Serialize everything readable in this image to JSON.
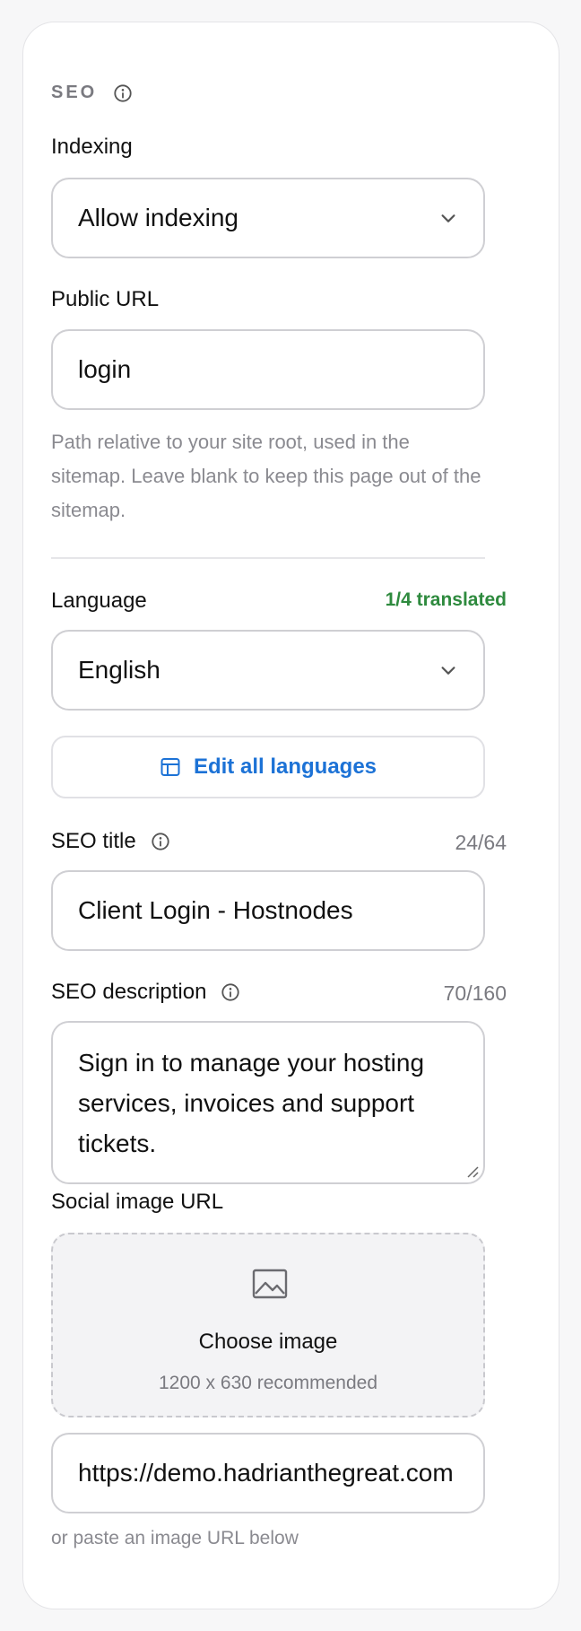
{
  "seo": {
    "section_title": "SEO",
    "indexing": {
      "label": "Indexing",
      "value": "Allow indexing"
    },
    "public_url": {
      "label": "Public URL",
      "value": "login",
      "help": "Path relative to your site root, used in the sitemap. Leave blank to keep this page out of the sitemap."
    },
    "language": {
      "label": "Language",
      "value": "English",
      "translated": "1/4 translated"
    },
    "edit_languages_label": "Edit all languages",
    "seo_title": {
      "label": "SEO title",
      "counter": "24/64",
      "value": "Client Login - Hostnodes"
    },
    "seo_description": {
      "label": "SEO description",
      "counter": "70/160",
      "value": "Sign in to manage your hosting services, invoices and support tickets."
    },
    "social_image": {
      "label": "Social image URL",
      "choose_label": "Choose image",
      "recommended": "1200 x 630 recommended",
      "url_value": "https://demo.hadrianthegreat.com",
      "help": "or paste an image URL below"
    }
  },
  "colors": {
    "accent": "#1c72d6",
    "success": "#2e8a3e",
    "border": "#cfcfd3",
    "muted": "#7a7a80"
  },
  "icons": {
    "info": "info-icon",
    "chevron": "chevron-down-icon",
    "layout": "layout-icon",
    "image": "image-icon"
  }
}
